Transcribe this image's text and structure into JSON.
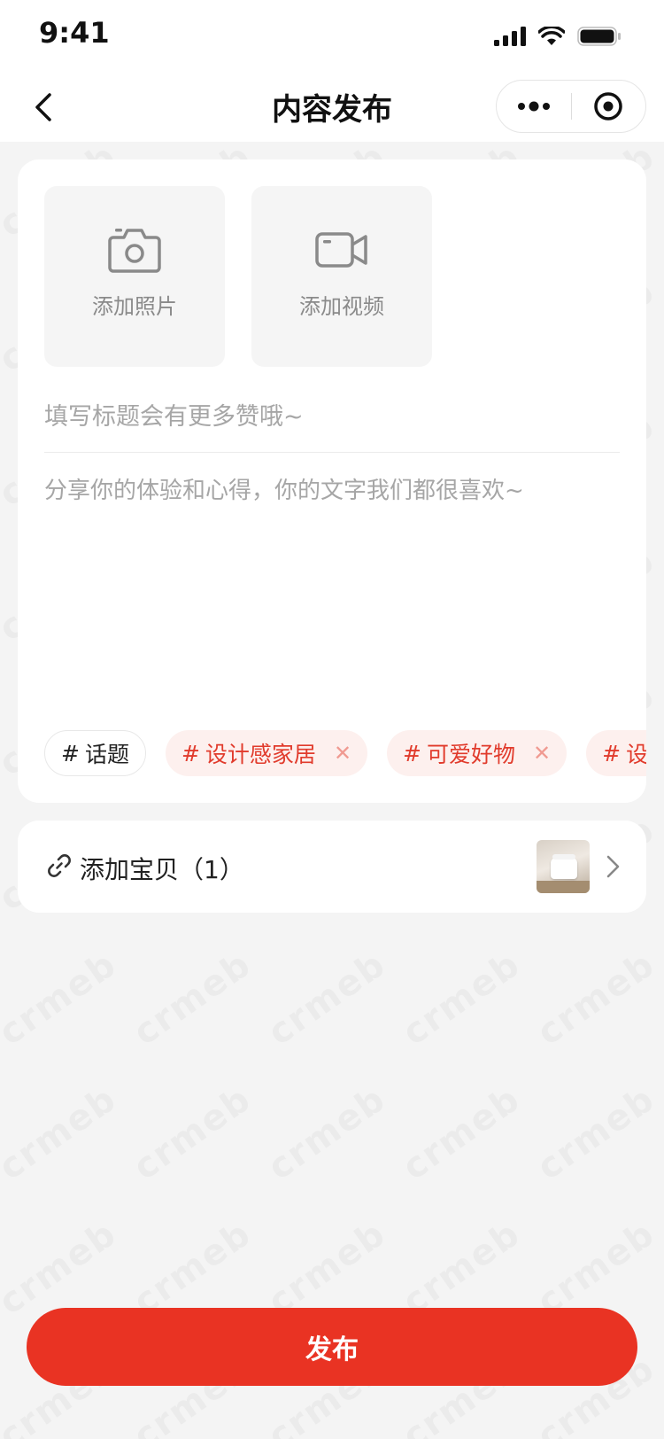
{
  "status_bar": {
    "time": "9:41"
  },
  "nav": {
    "title": "内容发布"
  },
  "upload": {
    "photo_label": "添加照片",
    "video_label": "添加视频"
  },
  "editor": {
    "title_placeholder": "填写标题会有更多赞哦~",
    "content_placeholder": "分享你的体验和心得，你的文字我们都很喜欢~"
  },
  "tags": {
    "hash": "#",
    "topic_label": "话题",
    "items": [
      "设计感家居",
      "可爱好物",
      "设计感"
    ]
  },
  "product": {
    "label": "添加宝贝（1）"
  },
  "publish_label": "发布",
  "watermark": "crmeb",
  "colors": {
    "accent": "#e93323",
    "tag_bg": "#fdf0ee",
    "page_bg": "#f4f4f4"
  }
}
